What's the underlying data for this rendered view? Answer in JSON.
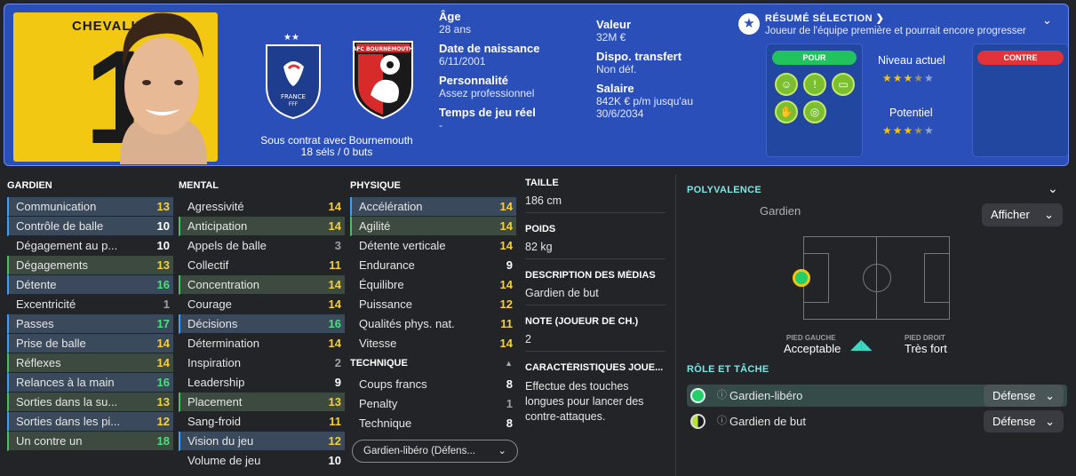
{
  "player": {
    "name": "CHEVALIER",
    "number": "1"
  },
  "nation": {
    "name": "FRANCE",
    "sub": "FFF"
  },
  "club": {
    "name": "AFC BOURNEMOUTH"
  },
  "contract": {
    "line1": "Sous contrat avec Bournemouth",
    "line2": "18 séls / 0 buts"
  },
  "info": {
    "age_label": "Âge",
    "age": "28 ans",
    "dob_label": "Date de naissance",
    "dob": "6/11/2001",
    "personality_label": "Personnalité",
    "personality": "Assez professionnel",
    "playtime_label": "Temps de jeu réel",
    "playtime": "-",
    "value_label": "Valeur",
    "value": "32M €",
    "transfer_label": "Dispo. transfert",
    "transfer": "Non déf.",
    "salary_label": "Salaire",
    "salary_1": "842K € p/m jusqu'au",
    "salary_2": "30/6/2034"
  },
  "summary": {
    "title": "RÉSUMÉ SÉLECTION",
    "subtitle": "Joueur de l'équipe première et pourrait encore progresser",
    "pour": "POUR",
    "contre": "CONTRE",
    "current_label": "Niveau actuel",
    "potential_label": "Potentiel",
    "current_stars": 3.5,
    "potential_stars": 3.5
  },
  "gardien": {
    "header": "GARDIEN",
    "rows": [
      {
        "name": "Communication",
        "val": "13"
      },
      {
        "name": "Contrôle de balle",
        "val": "10"
      },
      {
        "name": "Dégagement au p...",
        "val": "10"
      },
      {
        "name": "Dégagements",
        "val": "13"
      },
      {
        "name": "Détente",
        "val": "16"
      },
      {
        "name": "Excentricité",
        "val": "1"
      },
      {
        "name": "Passes",
        "val": "17"
      },
      {
        "name": "Prise de balle",
        "val": "14"
      },
      {
        "name": "Réflexes",
        "val": "14"
      },
      {
        "name": "Relances à la main",
        "val": "16"
      },
      {
        "name": "Sorties dans la su...",
        "val": "13"
      },
      {
        "name": "Sorties dans les pi...",
        "val": "12"
      },
      {
        "name": "Un contre un",
        "val": "18"
      }
    ]
  },
  "mental": {
    "header": "MENTAL",
    "rows": [
      {
        "name": "Agressivité",
        "val": "14"
      },
      {
        "name": "Anticipation",
        "val": "14"
      },
      {
        "name": "Appels de balle",
        "val": "3"
      },
      {
        "name": "Collectif",
        "val": "11"
      },
      {
        "name": "Concentration",
        "val": "14"
      },
      {
        "name": "Courage",
        "val": "14"
      },
      {
        "name": "Décisions",
        "val": "16"
      },
      {
        "name": "Détermination",
        "val": "14"
      },
      {
        "name": "Inspiration",
        "val": "2"
      },
      {
        "name": "Leadership",
        "val": "9"
      },
      {
        "name": "Placement",
        "val": "13"
      },
      {
        "name": "Sang-froid",
        "val": "11"
      },
      {
        "name": "Vision du jeu",
        "val": "12"
      },
      {
        "name": "Volume de jeu",
        "val": "10"
      }
    ]
  },
  "physique": {
    "header": "PHYSIQUE",
    "rows": [
      {
        "name": "Accélération",
        "val": "14"
      },
      {
        "name": "Agilité",
        "val": "14"
      },
      {
        "name": "Détente verticale",
        "val": "14"
      },
      {
        "name": "Endurance",
        "val": "9"
      },
      {
        "name": "Équilibre",
        "val": "14"
      },
      {
        "name": "Puissance",
        "val": "12"
      },
      {
        "name": "Qualités phys. nat.",
        "val": "11"
      },
      {
        "name": "Vitesse",
        "val": "14"
      }
    ]
  },
  "technique": {
    "header": "TECHNIQUE",
    "rows": [
      {
        "name": "Coups francs",
        "val": "8"
      },
      {
        "name": "Penalty",
        "val": "1"
      },
      {
        "name": "Technique",
        "val": "8"
      }
    ]
  },
  "role_select": "Gardien-libéro (Défens...",
  "details": {
    "height_label": "TAILLE",
    "height": "186 cm",
    "weight_label": "POIDS",
    "weight": "82 kg",
    "media_label": "DESCRIPTION DES MÉDIAS",
    "media": "Gardien de but",
    "rating_label": "NOTE (JOUEUR DE CH.)",
    "rating": "2",
    "traits_label": "CARACTÉRISTIQUES JOUE...",
    "traits": "Effectue des touches longues pour lancer des contre-attaques."
  },
  "polyvalence": {
    "title": "POLYVALENCE",
    "position": "Gardien",
    "show_btn": "Afficher",
    "left_foot_label": "PIED GAUCHE",
    "left_foot": "Acceptable",
    "right_foot_label": "PIED DROIT",
    "right_foot": "Très fort"
  },
  "roles": {
    "title": "RÔLE ET TÂCHE",
    "items": [
      {
        "name": "Gardien-libéro",
        "duty": "Défense"
      },
      {
        "name": "Gardien de but",
        "duty": "Défense"
      }
    ]
  },
  "colors": {
    "header_bg": "#2b4fb8",
    "accent_teal": "#7fe4e3",
    "good": "#4be07a",
    "ok": "#f4d03f"
  }
}
